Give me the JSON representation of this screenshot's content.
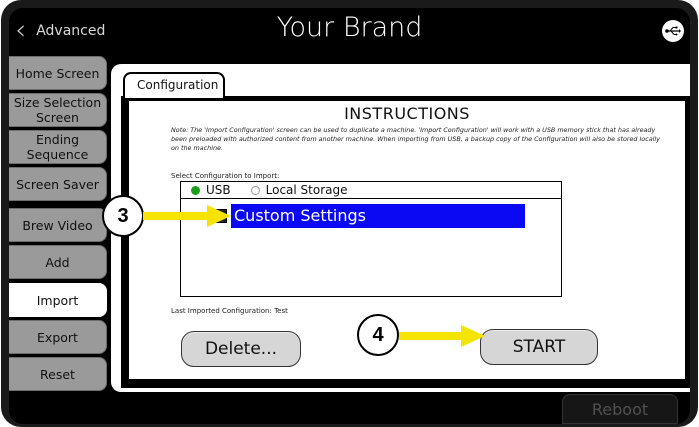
{
  "header": {
    "back_label": "Advanced",
    "title": "Your Brand",
    "usb_icon": "usb-icon"
  },
  "sidebar": {
    "items": [
      {
        "label": "Home Screen",
        "active": false
      },
      {
        "label": "Size Selection Screen",
        "active": false
      },
      {
        "label": "Ending Sequence",
        "active": false
      },
      {
        "label": "Screen Saver",
        "active": false
      },
      {
        "label": "Brew Video",
        "active": false
      },
      {
        "label": "Add",
        "active": false
      },
      {
        "label": "Import",
        "active": true
      },
      {
        "label": "Export",
        "active": false
      },
      {
        "label": "Reset",
        "active": false
      }
    ]
  },
  "main": {
    "tab_label": "Configuration",
    "instructions_title": "INSTRUCTIONS",
    "note": "Note: The 'Import Configuration' screen can be used to duplicate a machine. 'Import Configuration' will work with a USB memory stick that has already been preloaded with authorized content from another machine. When importing from USB, a backup copy of the Configuration will also be stored locally on the machine.",
    "select_label": "Select Configuration to Import:",
    "source_options": [
      {
        "label": "USB",
        "selected": true
      },
      {
        "label": "Local Storage",
        "selected": false
      }
    ],
    "list_items": [
      {
        "label": "Custom Settings",
        "selected": true
      }
    ],
    "last_imported": "Last Imported Configuration: Test",
    "delete_label": "Delete...",
    "start_label": "START"
  },
  "footer": {
    "reboot_label": "Reboot"
  },
  "callouts": {
    "step3": "3",
    "step4": "4"
  },
  "colors": {
    "selection": "#0b09f4",
    "radio_on": "#18a018",
    "arrow": "#f5e400",
    "sidebar_tab": "#9a9a9a"
  }
}
